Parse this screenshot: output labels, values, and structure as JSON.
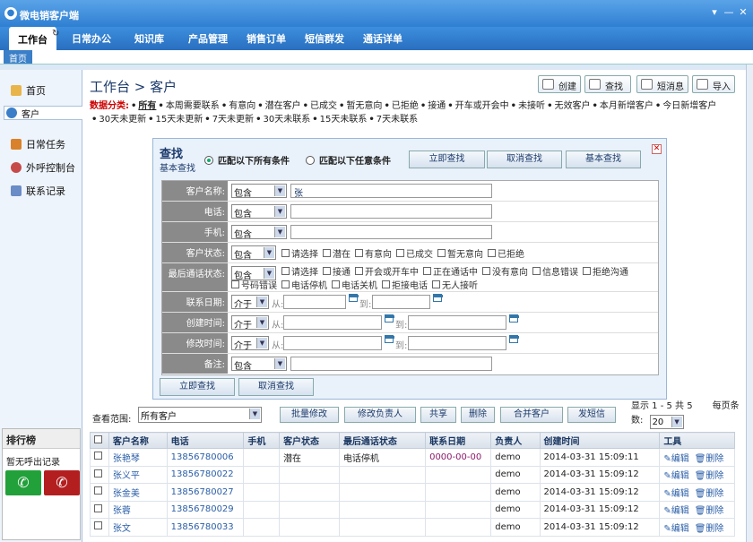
{
  "app": {
    "title": "微电销客户端",
    "window_buttons": [
      "▾",
      "—",
      "✕"
    ]
  },
  "menu": [
    {
      "label": "工作台",
      "active": true
    },
    {
      "label": "日常办公"
    },
    {
      "label": "知识库"
    },
    {
      "label": "产品管理"
    },
    {
      "label": "销售订单"
    },
    {
      "label": "短信群发"
    },
    {
      "label": "通话详单"
    }
  ],
  "tabs": {
    "home": "首页"
  },
  "sidebar": {
    "items": [
      {
        "label": "首页"
      },
      {
        "label": "客户",
        "selected": true
      },
      {
        "label": "日常任务"
      },
      {
        "label": "外呼控制台"
      },
      {
        "label": "联系记录"
      }
    ]
  },
  "rank": {
    "title": "排行榜",
    "empty": "暂无呼出记录"
  },
  "page": {
    "title": "工作台 > 客户"
  },
  "toolbar": {
    "create": "创建",
    "find": "查找",
    "message": "短消息",
    "import": "导入"
  },
  "categories": {
    "label": "数据分类:",
    "items": [
      "所有",
      "本周需要联系",
      "有意向",
      "潜在客户",
      "已成交",
      "暂无意向",
      "已拒绝",
      "接通",
      "开车或开会中",
      "未接听",
      "无效客户",
      "本月新增客户",
      "今日新增客户",
      "30天未更新",
      "15天未更新",
      "7天未更新",
      "30天未联系",
      "15天未联系",
      "7天未联系"
    ]
  },
  "search": {
    "title": "查找",
    "subtitle": "基本查找",
    "match_all": "匹配以下所有条件",
    "match_any": "匹配以下任意条件",
    "btn_search": "立即查找",
    "btn_cancel": "取消查找",
    "btn_basic": "基本查找",
    "labels": {
      "name": "客户名称:",
      "phone": "电话:",
      "mobile": "手机:",
      "status": "客户状态:",
      "last_call": "最后通话状态:",
      "contact_date": "联系日期:",
      "created": "创建时间:",
      "modified": "修改时间:",
      "remark": "备注:"
    },
    "op_contains": "包含",
    "op_between": "介于",
    "from": "从:",
    "to": "到:",
    "name_value": "张",
    "status_options": [
      "请选择",
      "潜在",
      "有意向",
      "已成交",
      "暂无意向",
      "已拒绝"
    ],
    "call_options_1": [
      "请选择",
      "接通",
      "开会或开车中",
      "正在通话中",
      "没有意向",
      "信息错误",
      "拒绝沟通"
    ],
    "call_options_2": [
      "号码错误",
      "电话停机",
      "电话关机",
      "拒接电话",
      "无人接听"
    ]
  },
  "list": {
    "scope_label": "查看范围:",
    "scope_value": "所有客户",
    "actions": [
      "批量修改",
      "修改负责人",
      "共享",
      "删除",
      "合并客户",
      "发短信"
    ],
    "page_info": "显示 1 - 5 共 5",
    "per_page_label": "每页条数:",
    "per_page": "20",
    "columns": [
      "客户名称",
      "电话",
      "手机",
      "客户状态",
      "最后通话状态",
      "联系日期",
      "负责人",
      "创建时间",
      "工具"
    ],
    "edit": "编辑",
    "delete": "删除",
    "rows": [
      {
        "name": "张艳琴",
        "phone": "13856780006",
        "mobile": "",
        "status": "潜在",
        "last_call": "电话停机",
        "date": "0000-00-00",
        "owner": "demo",
        "created": "2014-03-31 15:09:11"
      },
      {
        "name": "张义平",
        "phone": "13856780022",
        "mobile": "",
        "status": "",
        "last_call": "",
        "date": "",
        "owner": "demo",
        "created": "2014-03-31 15:09:12"
      },
      {
        "name": "张金美",
        "phone": "13856780027",
        "mobile": "",
        "status": "",
        "last_call": "",
        "date": "",
        "owner": "demo",
        "created": "2014-03-31 15:09:12"
      },
      {
        "name": "张蓉",
        "phone": "13856780029",
        "mobile": "",
        "status": "",
        "last_call": "",
        "date": "",
        "owner": "demo",
        "created": "2014-03-31 15:09:12"
      },
      {
        "name": "张文",
        "phone": "13856780033",
        "mobile": "",
        "status": "",
        "last_call": "",
        "date": "",
        "owner": "demo",
        "created": "2014-03-31 15:09:12"
      }
    ]
  }
}
